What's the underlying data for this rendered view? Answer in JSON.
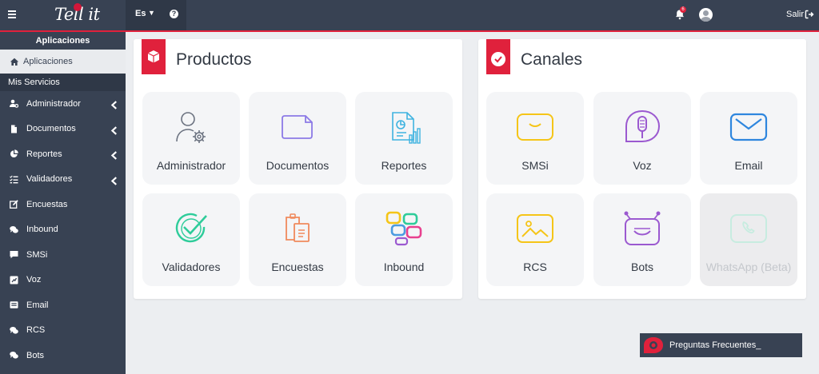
{
  "header": {
    "logo_text": "Tell it",
    "language": "Es",
    "notification_count": "6",
    "logout_label": "Salir"
  },
  "sidebar": {
    "heading": "Aplicaciones",
    "active_item": "Aplicaciones",
    "section_label": "Mis Servicios",
    "items": [
      {
        "label": "Administrador",
        "icon": "user-cog-icon",
        "expandable": true
      },
      {
        "label": "Documentos",
        "icon": "document-icon",
        "expandable": true
      },
      {
        "label": "Reportes",
        "icon": "pie-chart-icon",
        "expandable": true
      },
      {
        "label": "Validadores",
        "icon": "list-check-icon",
        "expandable": true
      },
      {
        "label": "Encuestas",
        "icon": "edit-icon",
        "expandable": false
      },
      {
        "label": "Inbound",
        "icon": "chat-icon",
        "expandable": false
      },
      {
        "label": "SMSi",
        "icon": "message-icon",
        "expandable": false
      },
      {
        "label": "Voz",
        "icon": "voice-icon",
        "expandable": false
      },
      {
        "label": "Email",
        "icon": "email-icon",
        "expandable": false
      },
      {
        "label": "RCS",
        "icon": "rcs-icon",
        "expandable": false
      },
      {
        "label": "Bots",
        "icon": "bot-icon",
        "expandable": false
      }
    ]
  },
  "products": {
    "title": "Productos",
    "tiles": [
      {
        "label": "Administrador",
        "icon": "admin-gear-icon"
      },
      {
        "label": "Documentos",
        "icon": "document-icon"
      },
      {
        "label": "Reportes",
        "icon": "report-icon"
      },
      {
        "label": "Validadores",
        "icon": "validator-check-icon"
      },
      {
        "label": "Encuestas",
        "icon": "survey-clipboard-icon"
      },
      {
        "label": "Inbound",
        "icon": "inbound-blocks-icon"
      }
    ]
  },
  "channels": {
    "title": "Canales",
    "tiles": [
      {
        "label": "SMSi",
        "icon": "sms-bubble-icon"
      },
      {
        "label": "Voz",
        "icon": "voice-mic-icon"
      },
      {
        "label": "Email",
        "icon": "email-envelope-icon"
      },
      {
        "label": "RCS",
        "icon": "rcs-image-icon"
      },
      {
        "label": "Bots",
        "icon": "bot-face-icon"
      },
      {
        "label": "WhatsApp (Beta)",
        "icon": "whatsapp-phone-icon",
        "disabled": true
      }
    ]
  },
  "faq": {
    "label": "Preguntas Frecuentes_"
  },
  "colors": {
    "topbar": "#384253",
    "accent": "#e0213c",
    "page_bg": "#eceef1",
    "tile_bg": "#f4f5f7",
    "yellow": "#f5c518",
    "purple": "#9b59d0",
    "blue": "#2e86de",
    "teal": "#2ecc9a",
    "orange": "#f08a5d"
  }
}
